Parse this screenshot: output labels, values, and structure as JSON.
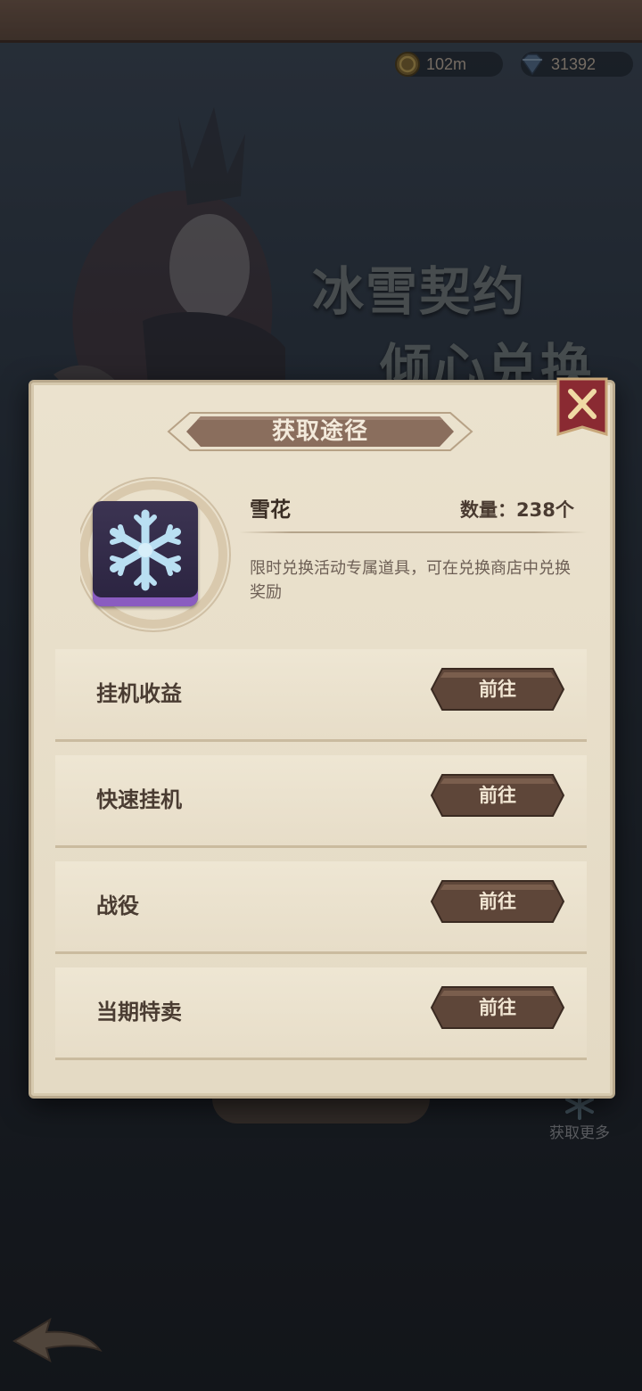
{
  "currencies": {
    "gold": {
      "icon": "gold-coin-icon",
      "value": "102m"
    },
    "gem": {
      "icon": "diamond-icon",
      "value": "31392"
    }
  },
  "banner": {
    "line1": "冰雪契约",
    "line2": "倾心兑换"
  },
  "background": {
    "more_label": "获取更多"
  },
  "modal": {
    "title": "获取途径",
    "item": {
      "name": "雪花",
      "count_label": "数量：238个",
      "icon": "snowflake-icon",
      "description": "限时兑换活动专属道具，可在兑换商店中兑换奖励"
    },
    "sources": [
      {
        "label": "挂机收益",
        "button": "前往"
      },
      {
        "label": "快速挂机",
        "button": "前往"
      },
      {
        "label": "战役",
        "button": "前往"
      },
      {
        "label": "当期特卖",
        "button": "前往"
      }
    ]
  },
  "colors": {
    "parchment": "#e9e0cb",
    "button_brown": "#5e4639",
    "title_plate": "#8a6e5d",
    "close_red": "#8a2a32",
    "snowflake": "#b9dff2",
    "item_rarity_purple": "#8a5cc0"
  }
}
